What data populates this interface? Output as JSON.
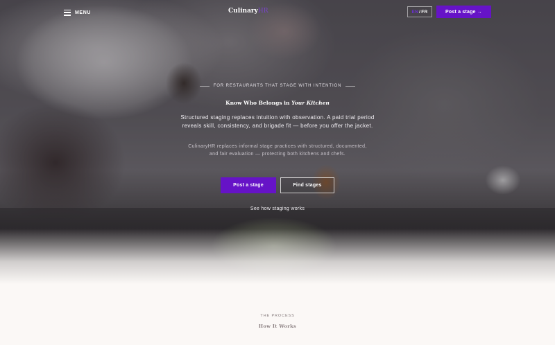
{
  "nav": {
    "menu_label": "MENU",
    "logo_main": "Culinary",
    "logo_accent": "HR",
    "lang_en": "EN",
    "lang_sep": "/",
    "lang_fr": "FR",
    "cta_label": "Post a stage →"
  },
  "hero": {
    "eyebrow": "FOR RESTAURANTS THAT STAGE WITH INTENTION",
    "title_plain": "Know Who Belongs in ",
    "title_italic": "Your Kitchen",
    "lead": "Structured staging replaces intuition with observation. A paid trial period reveals skill, consistency, and brigade fit — before you offer the jacket.",
    "sub": "CulinaryHR replaces informal stage practices with structured, documented, and fair evaluation — protecting both kitchens and chefs.",
    "primary_button": "Post a stage",
    "secondary_button": "Find stages",
    "link": "See how staging works"
  },
  "process": {
    "eyebrow": "THE PROCESS",
    "title": "How It Works"
  },
  "colors": {
    "accent": "#6613c7",
    "logo_accent": "#7a45c8",
    "page_bg": "#fbf8f6"
  }
}
